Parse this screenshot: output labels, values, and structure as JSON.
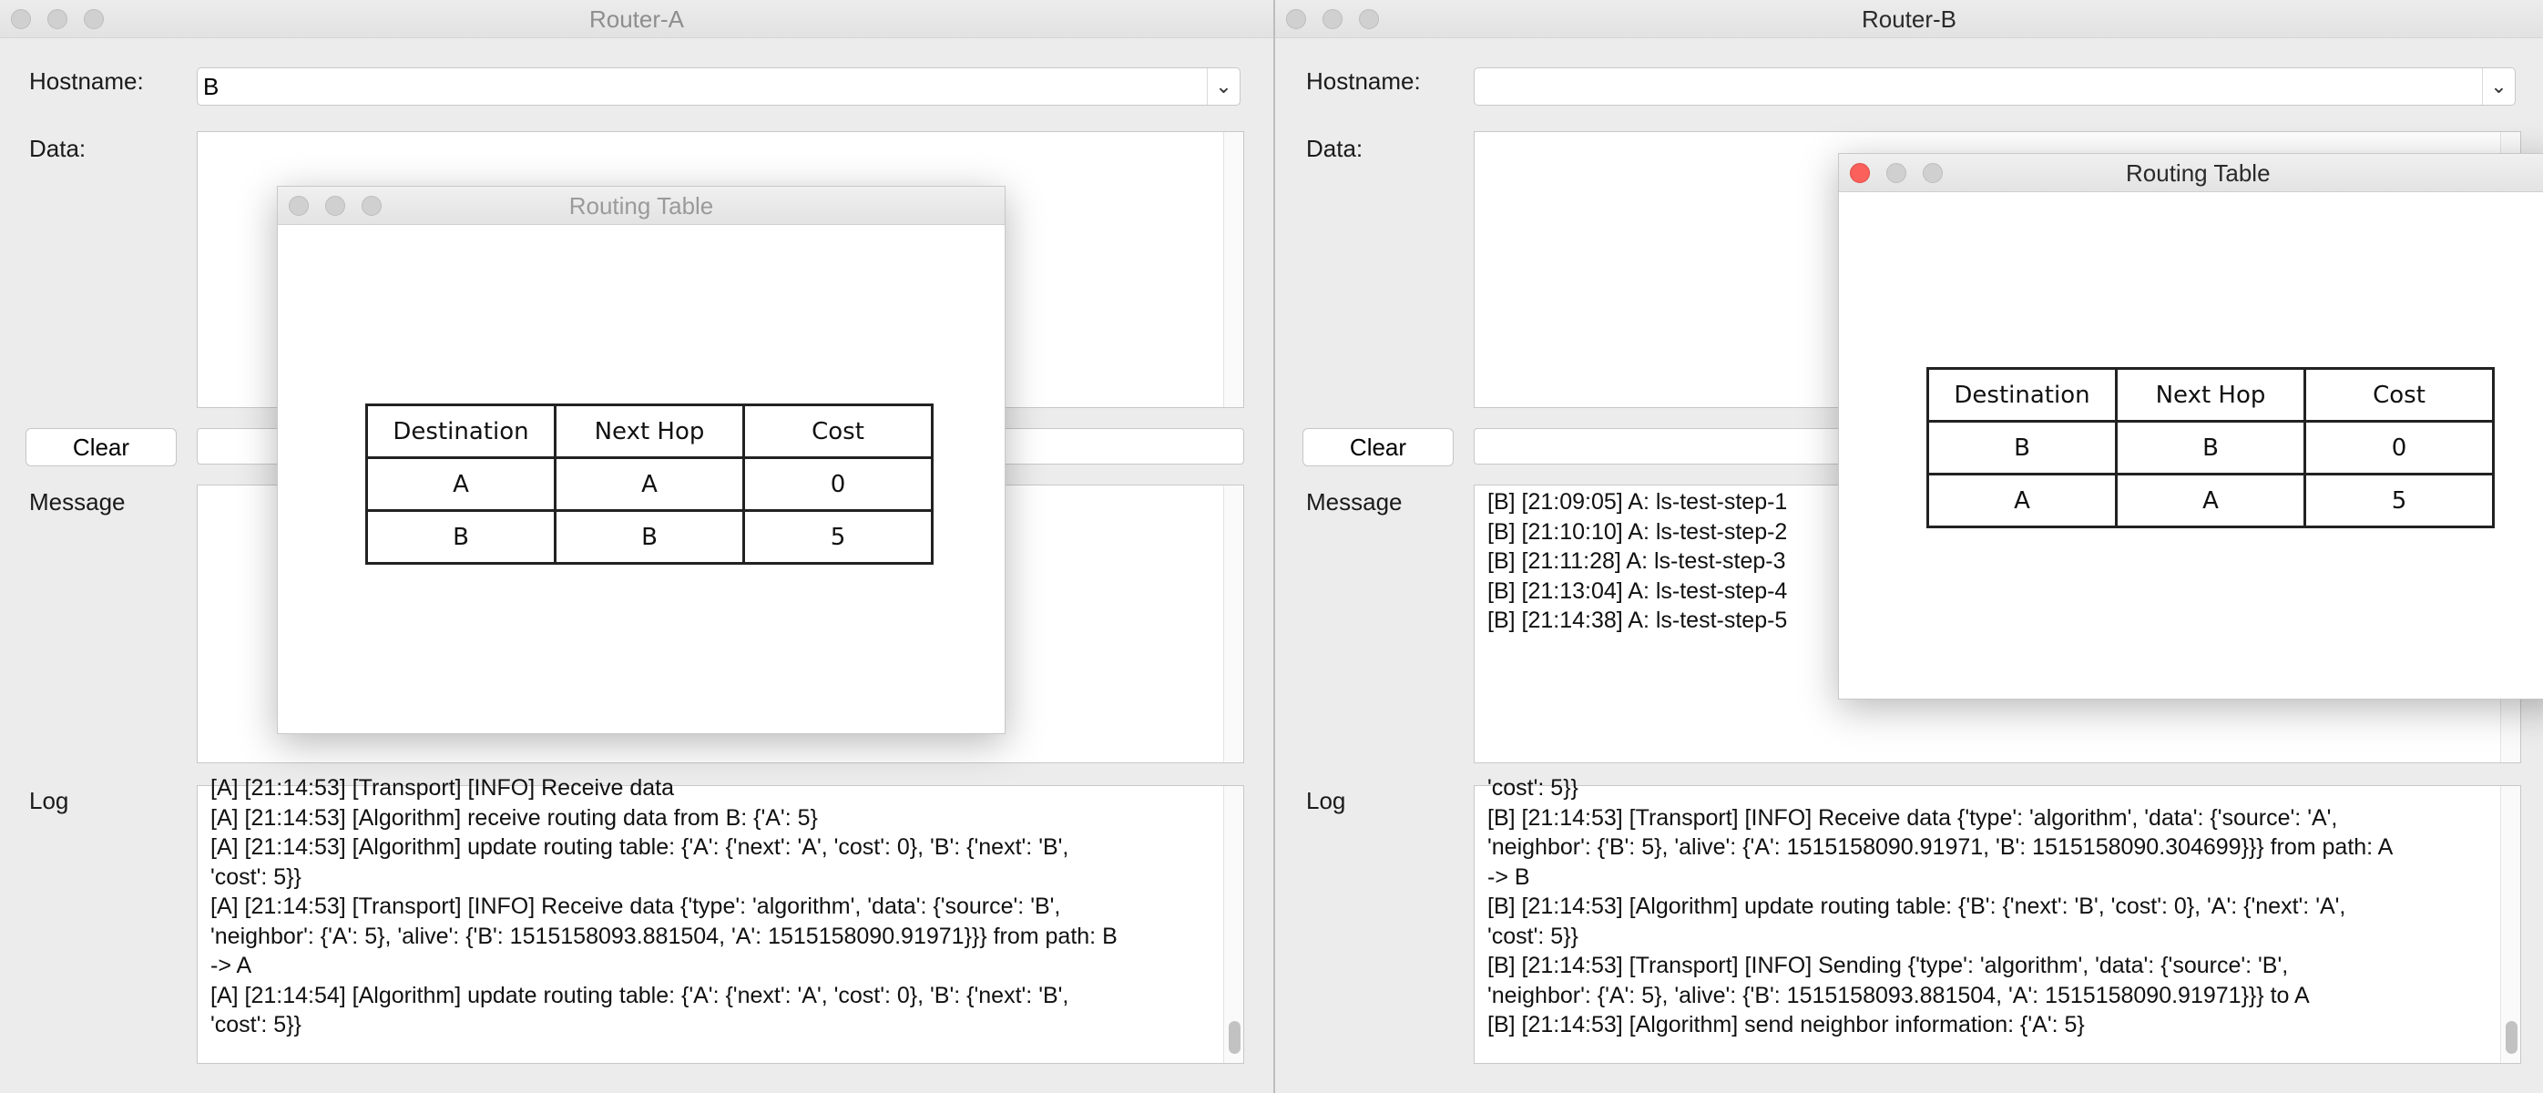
{
  "router_a": {
    "title": "Router-A",
    "hostname_label": "Hostname:",
    "hostname_value": "B",
    "data_label": "Data:",
    "clear_label": "Clear",
    "message_label": "Message",
    "message_lines": "",
    "log_label": "Log",
    "log_text": "[A] [21:14:53] [Transport] [INFO] Receive data\n[A] [21:14:53] [Algorithm] receive routing data from B: {'A': 5}\n[A] [21:14:53] [Algorithm] update routing table: {'A': {'next': 'A', 'cost': 0}, 'B': {'next': 'B',\n'cost': 5}}\n[A] [21:14:53] [Transport] [INFO] Receive data {'type': 'algorithm', 'data': {'source': 'B',\n'neighbor': {'A': 5}, 'alive': {'B': 1515158093.881504, 'A': 1515158090.91971}}} from path: B\n-> A\n[A] [21:14:54] [Algorithm] update routing table: {'A': {'next': 'A', 'cost': 0}, 'B': {'next': 'B',\n'cost': 5}}",
    "routing_table": {
      "title": "Routing Table",
      "headers": [
        "Destination",
        "Next Hop",
        "Cost"
      ],
      "rows": [
        [
          "A",
          "A",
          "0"
        ],
        [
          "B",
          "B",
          "5"
        ]
      ]
    }
  },
  "router_b": {
    "title": "Router-B",
    "hostname_label": "Hostname:",
    "hostname_value": "",
    "data_label": "Data:",
    "clear_label": "Clear",
    "message_label": "Message",
    "message_lines": "[B] [21:09:05] A: ls-test-step-1\n[B] [21:10:10] A: ls-test-step-2\n[B] [21:11:28] A: ls-test-step-3\n[B] [21:13:04] A: ls-test-step-4\n[B] [21:14:38] A: ls-test-step-5",
    "log_label": "Log",
    "log_text": "'cost': 5}}\n[B] [21:14:53] [Transport] [INFO] Receive data {'type': 'algorithm', 'data': {'source': 'A',\n'neighbor': {'B': 5}, 'alive': {'A': 1515158090.91971, 'B': 1515158090.304699}}} from path: A\n-> B\n[B] [21:14:53] [Algorithm] update routing table: {'B': {'next': 'B', 'cost': 0}, 'A': {'next': 'A',\n'cost': 5}}\n[B] [21:14:53] [Transport] [INFO] Sending {'type': 'algorithm', 'data': {'source': 'B',\n'neighbor': {'A': 5}, 'alive': {'B': 1515158093.881504, 'A': 1515158090.91971}}} to A\n[B] [21:14:53] [Algorithm] send neighbor information: {'A': 5}",
    "routing_table": {
      "title": "Routing Table",
      "headers": [
        "Destination",
        "Next Hop",
        "Cost"
      ],
      "rows": [
        [
          "B",
          "B",
          "0"
        ],
        [
          "A",
          "A",
          "5"
        ]
      ]
    }
  },
  "icons": {
    "close": "close-icon",
    "minimize": "minimize-icon",
    "zoom": "zoom-icon",
    "dropdown": "chevron-down-icon"
  },
  "colors": {
    "close_red": "#fc605b",
    "window_bg": "#ececec"
  }
}
